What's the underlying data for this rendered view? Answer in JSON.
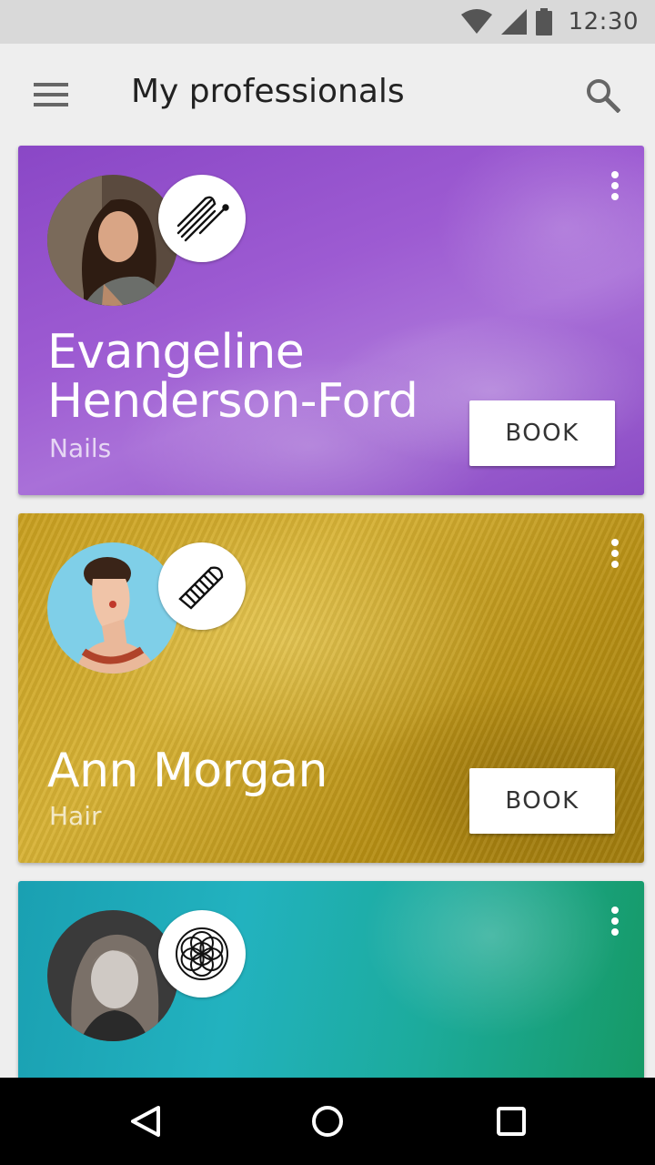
{
  "status_bar": {
    "time": "12:30",
    "icons": [
      "wifi-icon",
      "cellular-signal-icon",
      "battery-icon"
    ]
  },
  "app_bar": {
    "title": "My professionals",
    "menu_icon": "hamburger-menu-icon",
    "search_icon": "search-icon"
  },
  "professionals": [
    {
      "name_line1": "Evangeline",
      "name_line2": "Henderson-Ford",
      "category": "Nails",
      "category_icon": "nail-file-icon",
      "book_label": "BOOK",
      "accent": "#9b59d0"
    },
    {
      "name_line1": "Ann Morgan",
      "category": "Hair",
      "category_icon": "comb-icon",
      "book_label": "BOOK",
      "accent": "#c9a020"
    },
    {
      "category_icon": "flower-of-life-icon",
      "accent": "#1fa9b0"
    }
  ],
  "nav_bar": {
    "icons": [
      "back-icon",
      "home-icon",
      "recents-icon"
    ]
  }
}
